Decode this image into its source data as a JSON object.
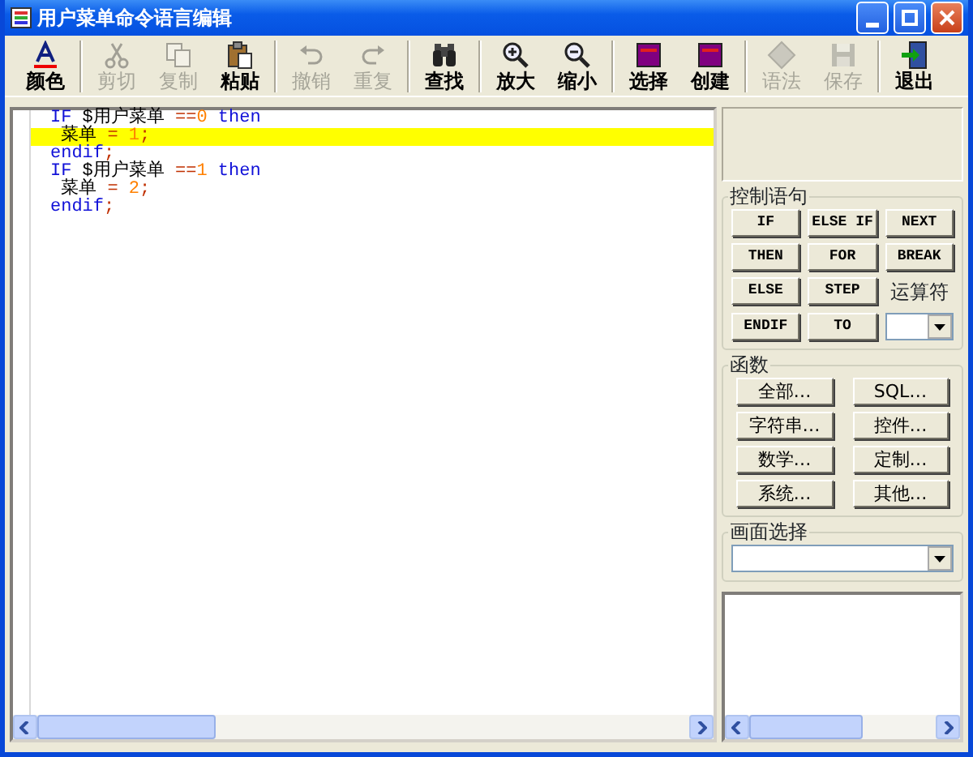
{
  "window": {
    "title": "用户菜单命令语言编辑"
  },
  "toolbar": {
    "groups": [
      {
        "buttons": [
          {
            "label": "颜色",
            "disabled": false
          }
        ]
      },
      {
        "buttons": [
          {
            "label": "剪切",
            "disabled": true
          },
          {
            "label": "复制",
            "disabled": true
          },
          {
            "label": "粘贴",
            "disabled": false
          }
        ]
      },
      {
        "buttons": [
          {
            "label": "撤销",
            "disabled": true
          },
          {
            "label": "重复",
            "disabled": true
          }
        ]
      },
      {
        "buttons": [
          {
            "label": "查找",
            "disabled": false
          }
        ]
      },
      {
        "buttons": [
          {
            "label": "放大",
            "disabled": false
          },
          {
            "label": "缩小",
            "disabled": false
          }
        ]
      },
      {
        "buttons": [
          {
            "label": "选择",
            "disabled": false
          },
          {
            "label": "创建",
            "disabled": false
          }
        ]
      },
      {
        "buttons": [
          {
            "label": "语法",
            "disabled": true
          },
          {
            "label": "保存",
            "disabled": true
          }
        ]
      },
      {
        "buttons": [
          {
            "label": "退出",
            "disabled": false
          }
        ]
      }
    ]
  },
  "editor": {
    "lines": [
      {
        "highlighted": false,
        "tokens": [
          {
            "text": "IF",
            "kind": "keyword"
          },
          {
            "text": " $用户菜单 ",
            "kind": "text"
          },
          {
            "text": "==",
            "kind": "operator"
          },
          {
            "text": "0",
            "kind": "number"
          },
          {
            "text": " then",
            "kind": "keyword"
          }
        ]
      },
      {
        "highlighted": true,
        "tokens": [
          {
            "text": " 菜单",
            "kind": "text"
          },
          {
            "text": " = ",
            "kind": "operator"
          },
          {
            "text": "1",
            "kind": "number"
          },
          {
            "text": ";",
            "kind": "operator"
          }
        ]
      },
      {
        "highlighted": false,
        "tokens": [
          {
            "text": "endif",
            "kind": "keyword"
          },
          {
            "text": ";",
            "kind": "operator"
          }
        ]
      },
      {
        "highlighted": false,
        "tokens": [
          {
            "text": "IF",
            "kind": "keyword"
          },
          {
            "text": " $用户菜单 ",
            "kind": "text"
          },
          {
            "text": "==",
            "kind": "operator"
          },
          {
            "text": "1",
            "kind": "number"
          },
          {
            "text": " then",
            "kind": "keyword"
          }
        ]
      },
      {
        "highlighted": false,
        "tokens": [
          {
            "text": " 菜单",
            "kind": "text"
          },
          {
            "text": " = ",
            "kind": "operator"
          },
          {
            "text": "2",
            "kind": "number"
          },
          {
            "text": ";",
            "kind": "operator"
          }
        ]
      },
      {
        "highlighted": false,
        "tokens": [
          {
            "text": "endif",
            "kind": "keyword"
          },
          {
            "text": ";",
            "kind": "operator"
          }
        ]
      }
    ]
  },
  "control_statements": {
    "title": "控制语句",
    "buttons": [
      "IF",
      "ELSE IF",
      "NEXT",
      "THEN",
      "FOR",
      "BREAK",
      "ELSE",
      "STEP",
      "ENDIF",
      "TO"
    ],
    "operator_label": "运算符"
  },
  "functions": {
    "title": "函数",
    "buttons": [
      "全部…",
      "SQL…",
      "字符串…",
      "控件…",
      "数学…",
      "定制…",
      "系统…",
      "其他…"
    ]
  },
  "screen_select": {
    "title": "画面选择"
  }
}
